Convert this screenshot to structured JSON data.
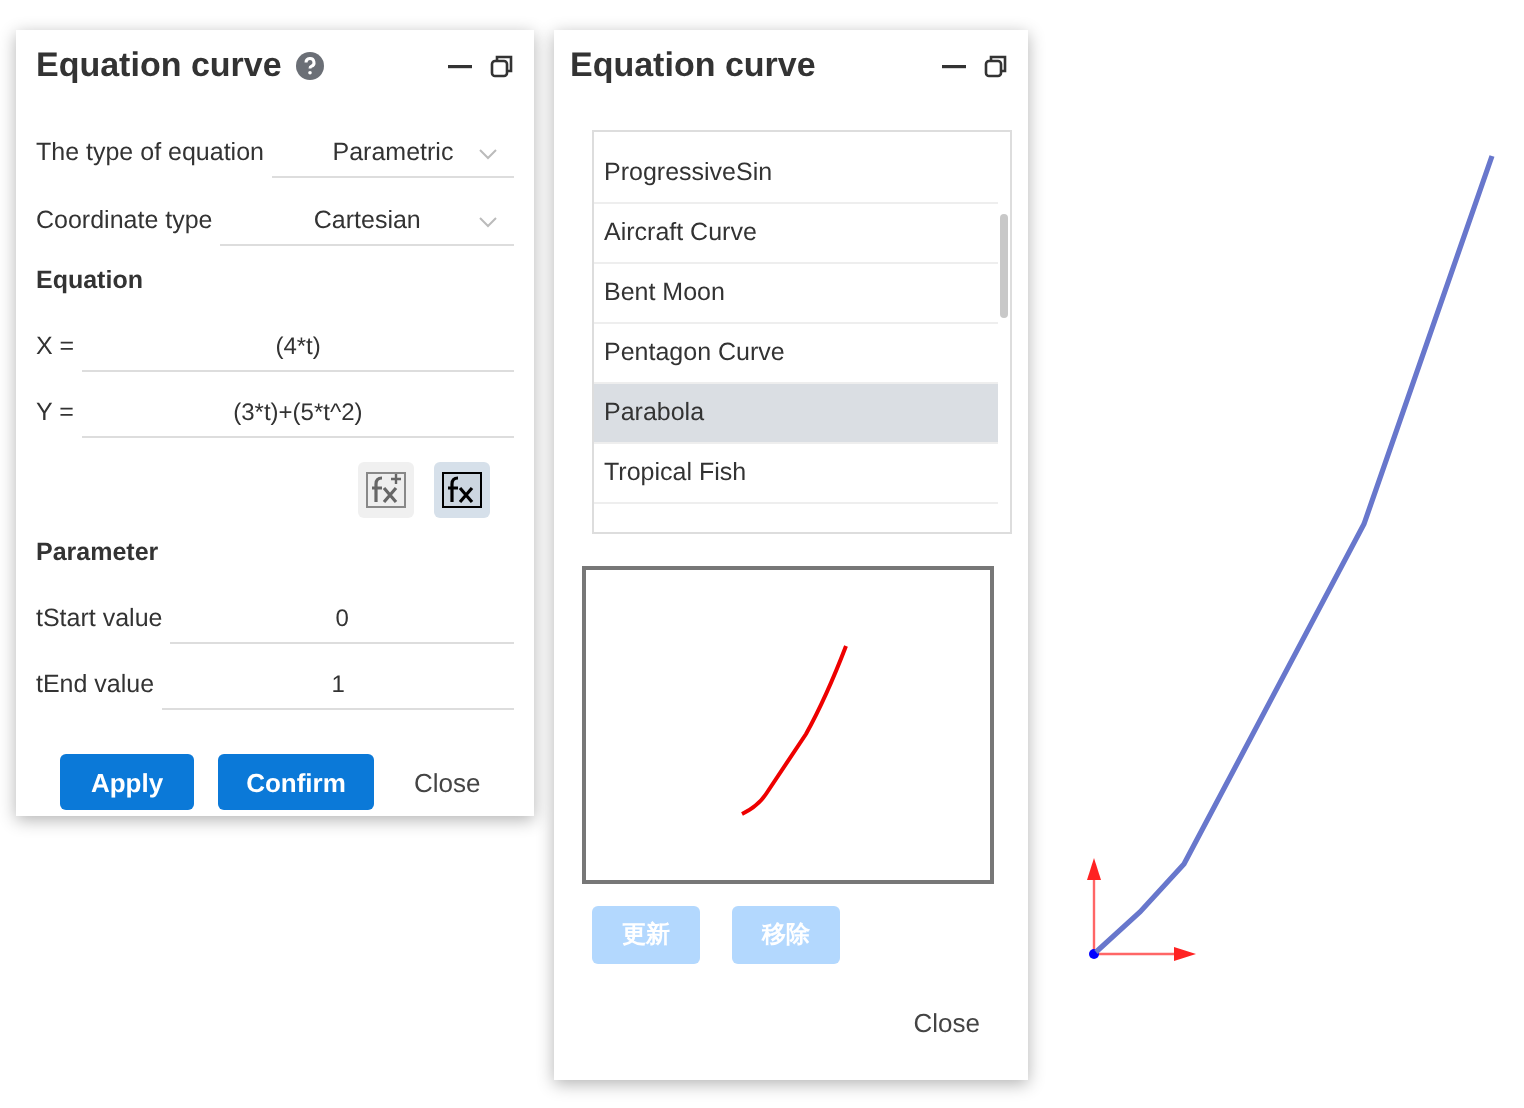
{
  "left_panel": {
    "title": "Equation curve",
    "fields": [
      {
        "kind": "select",
        "label": "The type of equation",
        "value": "Parametric"
      },
      {
        "kind": "select",
        "label": "Coordinate type",
        "value": "Cartesian"
      }
    ],
    "equation": {
      "heading": "Equation",
      "rows": [
        {
          "label": "X =",
          "value": "(4*t)"
        },
        {
          "label": "Y =",
          "value": "(3*t)+(5*t^2)"
        }
      ]
    },
    "tools": [
      {
        "selected": false
      },
      {
        "selected": true
      }
    ],
    "parameter": {
      "heading": "Parameter",
      "rows": [
        {
          "label": "tStart value",
          "value": "0"
        },
        {
          "label": "tEnd value",
          "value": "1"
        }
      ]
    },
    "buttons": [
      {
        "label": "Apply",
        "kind": "primary"
      },
      {
        "label": "Confirm",
        "kind": "primary"
      },
      {
        "label": "Close",
        "kind": "plain"
      }
    ]
  },
  "right_panel": {
    "title": "Equation curve",
    "presets": [
      {
        "label": "ProgressiveSin",
        "selected": false
      },
      {
        "label": "Aircraft Curve",
        "selected": false
      },
      {
        "label": "Bent Moon",
        "selected": false
      },
      {
        "label": "Pentagon Curve",
        "selected": false
      },
      {
        "label": "Parabola",
        "selected": true
      },
      {
        "label": "Tropical Fish",
        "selected": false
      }
    ],
    "buttons": [
      {
        "label": "更新",
        "disabled": true
      },
      {
        "label": "移除",
        "disabled": true
      }
    ],
    "close": "Close"
  }
}
